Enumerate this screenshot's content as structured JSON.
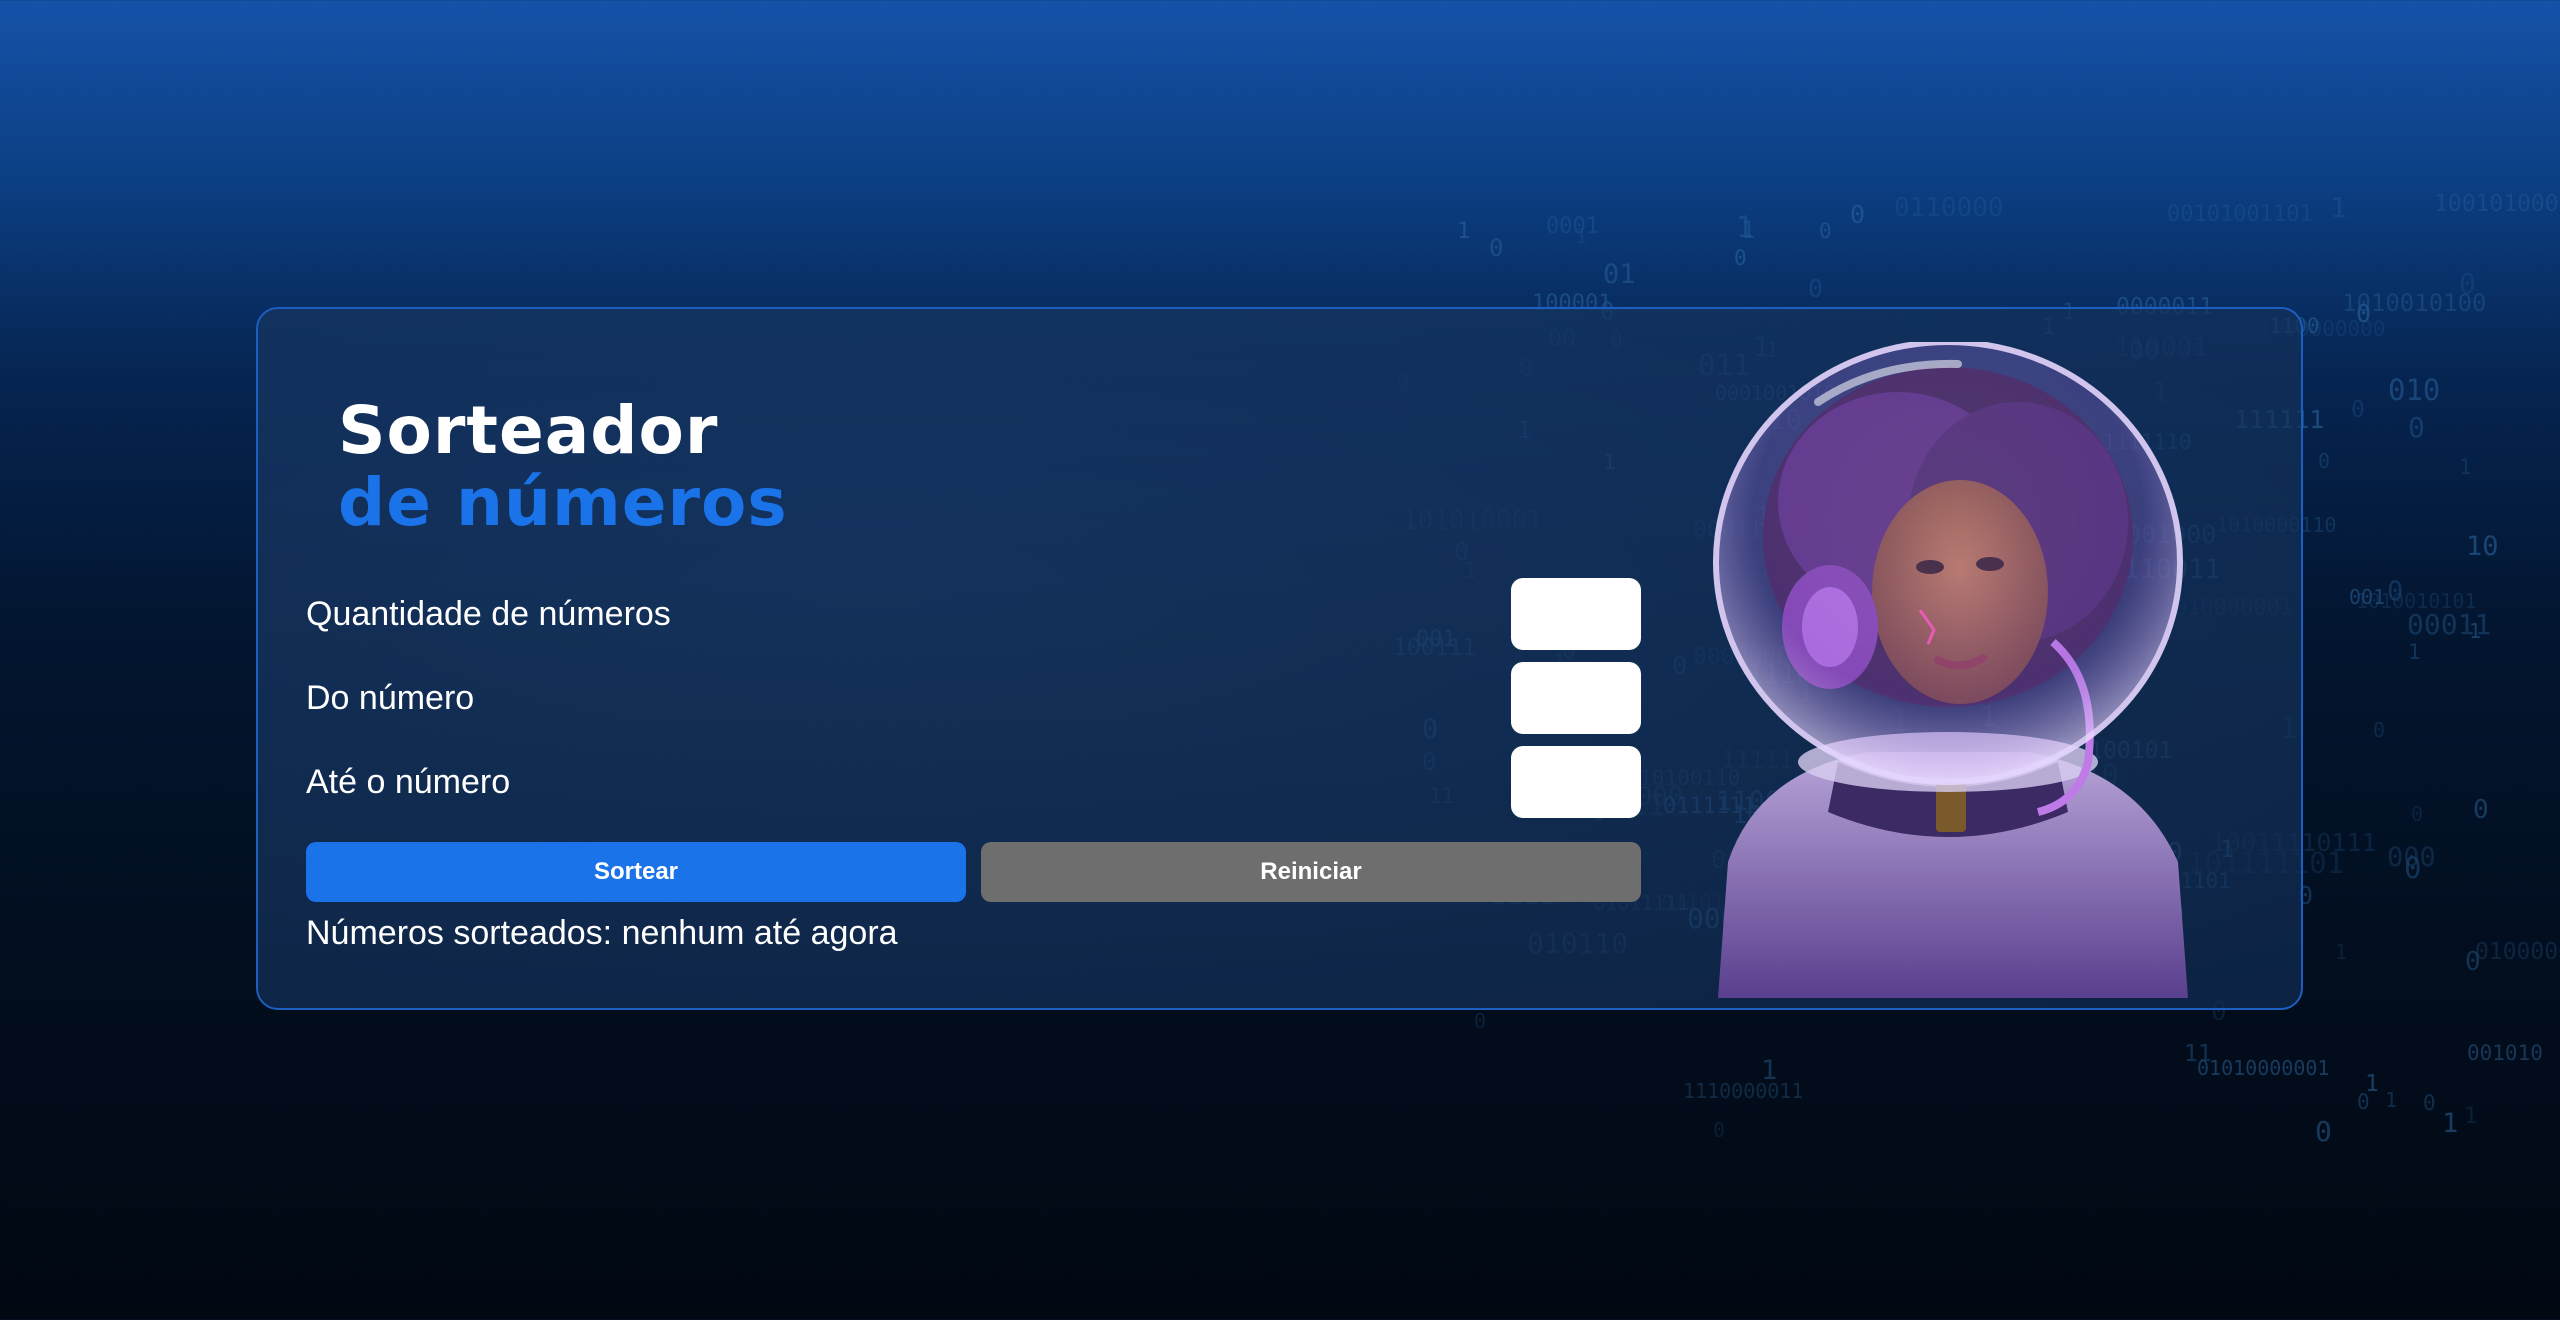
{
  "title": {
    "line1": "Sorteador",
    "line2": "de números"
  },
  "form": {
    "quantity_label": "Quantidade de números",
    "quantity_value": "",
    "from_label": "Do número",
    "from_value": "",
    "to_label": "Até o número",
    "to_value": ""
  },
  "buttons": {
    "draw_label": "Sortear",
    "reset_label": "Reiniciar"
  },
  "result_text": "Números sorteados: nenhum até agora",
  "colors": {
    "accent": "#1a73e8",
    "secondary_button": "#6e6e6e",
    "card_border": "#1b5fc0",
    "text": "#ffffff"
  },
  "illustration": {
    "name": "astronaut-illustration"
  }
}
